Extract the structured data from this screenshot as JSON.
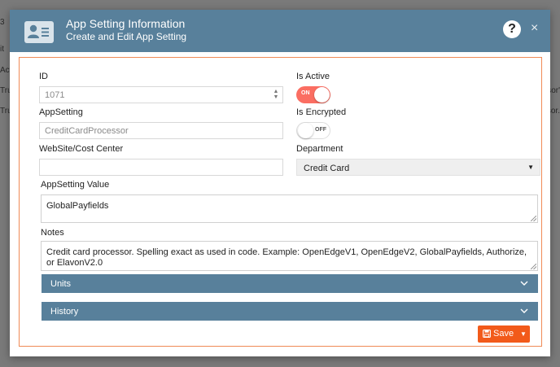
{
  "background": {
    "left_fragments": [
      "3",
      "it",
      "Acti",
      "True",
      "True"
    ],
    "right_fragments": [
      "ssor'",
      "ssor."
    ]
  },
  "header": {
    "title": "App Setting Information",
    "subtitle": "Create and Edit App Setting",
    "icon": "contact-card-icon",
    "help_label": "?",
    "close_label": "×"
  },
  "form": {
    "id": {
      "label": "ID",
      "value": "1071"
    },
    "is_active": {
      "label": "Is Active",
      "state": "ON"
    },
    "app_setting": {
      "label": "AppSetting",
      "placeholder": "CreditCardProcessor"
    },
    "is_encrypted": {
      "label": "Is Encrypted",
      "state": "OFF"
    },
    "website_cost_center": {
      "label": "WebSite/Cost Center",
      "value": ""
    },
    "department": {
      "label": "Department",
      "value": "Credit Card"
    },
    "app_setting_value": {
      "label": "AppSetting Value",
      "value": "GlobalPayfields"
    },
    "notes": {
      "label": "Notes",
      "value": "Credit card processor. Spelling exact as used in code. Example: OpenEdgeV1, OpenEdgeV2, GlobalPayfields, Authorize, or ElavonV2.0"
    }
  },
  "sections": [
    {
      "label": "Units"
    },
    {
      "label": "History"
    }
  ],
  "actions": {
    "save_label": "Save"
  },
  "colors": {
    "header": "#58809b",
    "accent": "#f25a1a",
    "toggle_on": "#fb6e62",
    "panel_border": "#f08a55"
  }
}
